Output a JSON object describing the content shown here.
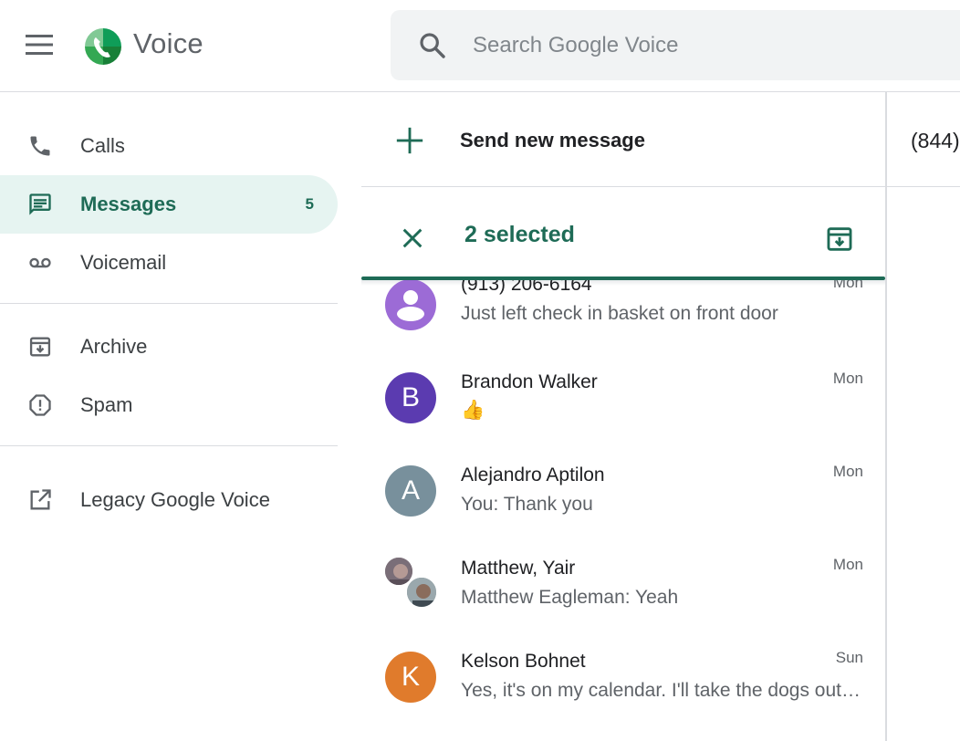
{
  "header": {
    "app_name": "Voice",
    "search_placeholder": "Search Google Voice"
  },
  "sidebar": {
    "items": [
      {
        "label": "Calls",
        "icon": "phone-icon"
      },
      {
        "label": "Messages",
        "icon": "message-icon",
        "badge": "5",
        "active": true
      },
      {
        "label": "Voicemail",
        "icon": "voicemail-icon"
      },
      {
        "label": "Archive",
        "icon": "archive-icon"
      },
      {
        "label": "Spam",
        "icon": "spam-icon"
      },
      {
        "label": "Legacy Google Voice",
        "icon": "open-in-new-icon"
      }
    ]
  },
  "middle": {
    "send_new_label": "Send new message",
    "selection": {
      "count_label": "2 selected"
    },
    "conversations": [
      {
        "name": "(913) 206-6164",
        "snippet": "Just left check in basket on front door",
        "time": "Mon",
        "avatar": "person-icon",
        "color": "#9c6bd6"
      },
      {
        "name": "Brandon Walker",
        "snippet": "👍",
        "time": "Mon",
        "initial": "B",
        "color": "#5b3bb0"
      },
      {
        "name": "Alejandro Aptilon",
        "snippet": "You: Thank you",
        "time": "Mon",
        "initial": "A",
        "color": "#78909c"
      },
      {
        "name": "Matthew, Yair",
        "snippet": "Matthew Eagleman: Yeah",
        "time": "Mon",
        "avatar": "group-photo"
      },
      {
        "name": "Kelson Bohnet",
        "snippet": "Yes, it's on my calendar. I'll take the dogs out to the park",
        "time": "Sun",
        "initial": "K",
        "color": "#e07b2c"
      }
    ]
  },
  "right": {
    "header_number": "(844)"
  },
  "colors": {
    "accent": "#1e6b56",
    "active_bg": "#e6f4f1"
  }
}
